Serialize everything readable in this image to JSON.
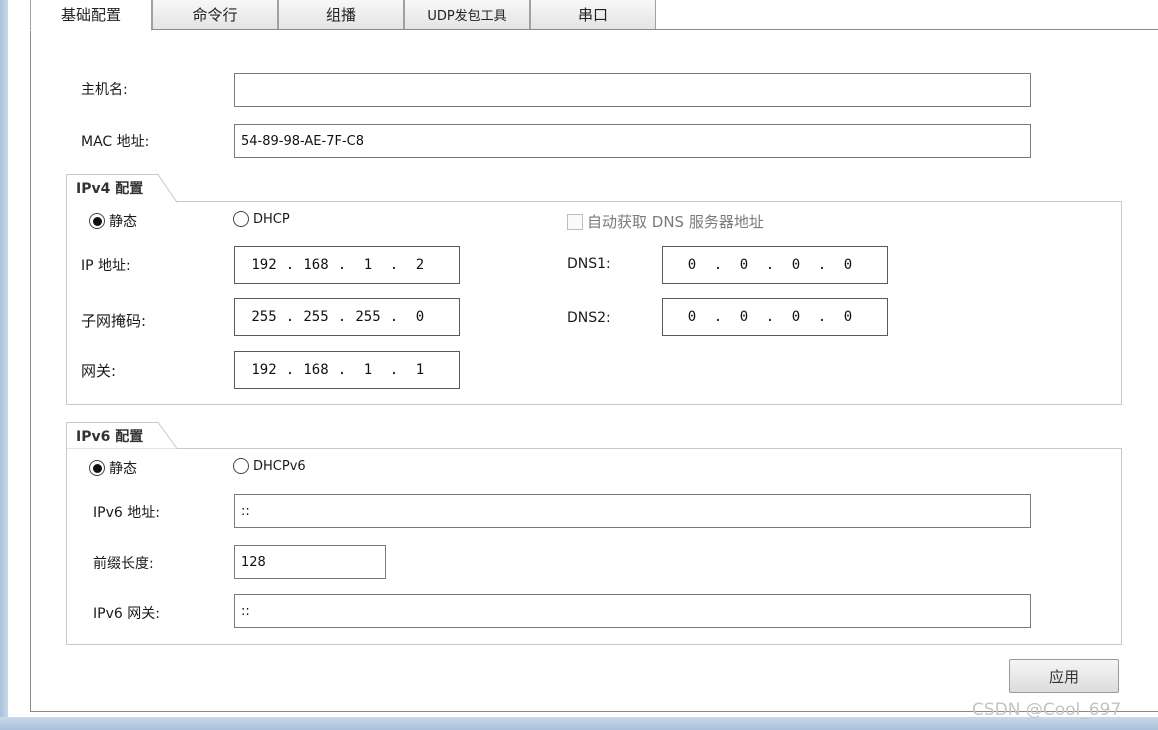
{
  "tabs": [
    {
      "label": "基础配置",
      "active": true
    },
    {
      "label": "命令行",
      "active": false
    },
    {
      "label": "组播",
      "active": false
    },
    {
      "label": "UDP发包工具",
      "active": false
    },
    {
      "label": "串口",
      "active": false
    }
  ],
  "basic": {
    "hostname_label": "主机名:",
    "hostname_value": "",
    "mac_label": "MAC 地址:",
    "mac_value": "54-89-98-AE-7F-C8"
  },
  "ipv4": {
    "title": "IPv4 配置",
    "static_label": "静态",
    "dhcp_label": "DHCP",
    "mode": "static",
    "auto_dns_label": "自动获取 DNS 服务器地址",
    "auto_dns_checked": false,
    "ip_label": "IP 地址:",
    "ip": [
      "192",
      "168",
      "1",
      "2"
    ],
    "mask_label": "子网掩码:",
    "mask": [
      "255",
      "255",
      "255",
      "0"
    ],
    "gateway_label": "网关:",
    "gateway": [
      "192",
      "168",
      "1",
      "1"
    ],
    "dns1_label": "DNS1:",
    "dns1": [
      "0",
      "0",
      "0",
      "0"
    ],
    "dns2_label": "DNS2:",
    "dns2": [
      "0",
      "0",
      "0",
      "0"
    ]
  },
  "ipv6": {
    "title": "IPv6 配置",
    "static_label": "静态",
    "dhcp_label": "DHCPv6",
    "mode": "static",
    "addr_label": "IPv6 地址:",
    "addr_value": "::",
    "prefix_label": "前缀长度:",
    "prefix_value": "128",
    "gateway_label": "IPv6 网关:",
    "gateway_value": "::"
  },
  "apply_label": "应用",
  "watermark": "CSDN @Cool_697"
}
